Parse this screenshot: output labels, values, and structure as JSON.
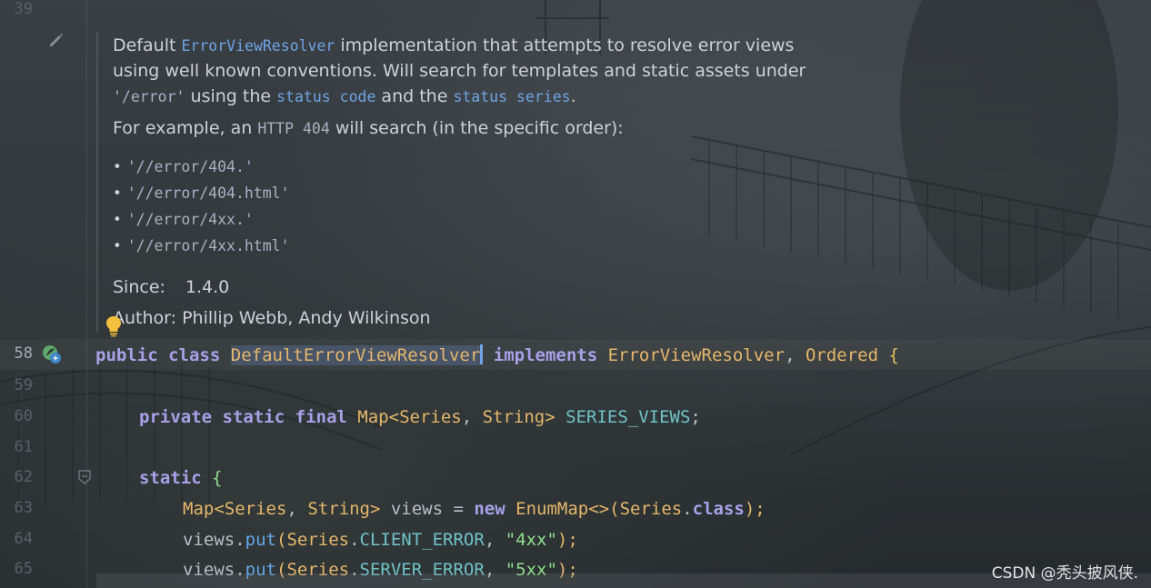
{
  "gutter": {
    "line_numbers": [
      "39",
      "58",
      "59",
      "60",
      "61",
      "62",
      "63",
      "64",
      "65"
    ]
  },
  "doc": {
    "p1_l1_a": "Default ",
    "p1_l1_link": "ErrorViewResolver",
    "p1_l1_b": " implementation that attempts to resolve error views",
    "p1_l2": "using well known conventions. Will search for templates and static assets under",
    "p1_l3_code": "'/error'",
    "p1_l3_a": " using the ",
    "p1_l3_link1": "status code",
    "p1_l3_b": " and the ",
    "p1_l3_link2": "status series",
    "p1_l3_c": ".",
    "p2_a": "For example, an ",
    "p2_code": "HTTP 404",
    "p2_b": " will search (in the specific order):",
    "bullets": [
      "'//error/404.'",
      "'//error/404.html'",
      "'//error/4xx.'",
      "'//error/4xx.html'"
    ],
    "since_label": "Since:",
    "since_value": "1.4.0",
    "author": "Author: Phillip Webb, Andy Wilkinson"
  },
  "code": {
    "l58": {
      "kw1": "public",
      "kw2": "class",
      "cls": "DefaultErrorViewResolver",
      "kw3": "implements",
      "iface1": "ErrorViewResolver",
      "comma": ",",
      "iface2": "Ordered",
      "brace": "{"
    },
    "l60": {
      "kw1": "private",
      "kw2": "static",
      "kw3": "final",
      "type1": "Map",
      "lt": "<",
      "type2": "Series",
      "comma": ", ",
      "type3": "String",
      "gt": ">",
      "field": "SERIES_VIEWS",
      "semi": ";"
    },
    "l62": {
      "kw": "static",
      "brace": "{"
    },
    "l63": {
      "type1": "Map",
      "lt": "<",
      "type2": "Series",
      "comma": ", ",
      "type3": "String",
      "gt": ">",
      "rest1": " views = ",
      "kw": "new",
      "type4": "EnumMap",
      "diamond": "<>",
      "open": "(",
      "type5": "Series",
      "dot": ".",
      "kw2": "class",
      "close": ");"
    },
    "l64": {
      "var": "views",
      "dot": ".",
      "method": "put",
      "open": "(",
      "type": "Series",
      "dot2": ".",
      "field": "CLIENT_ERROR",
      "comma": ", ",
      "str": "\"4xx\"",
      "close": ");"
    },
    "l65": {
      "var": "views",
      "dot": ".",
      "method": "put",
      "open": "(",
      "type": "Series",
      "dot2": ".",
      "field": "SERVER_ERROR",
      "comma": ", ",
      "str": "\"5xx\"",
      "close": ");"
    }
  },
  "icons": {
    "edit": "pencil-icon",
    "intention": "lightbulb-icon",
    "run": "spring-bean-icon",
    "fold": "fold-marker-icon"
  },
  "watermark": "CSDN @秃头披风侠."
}
